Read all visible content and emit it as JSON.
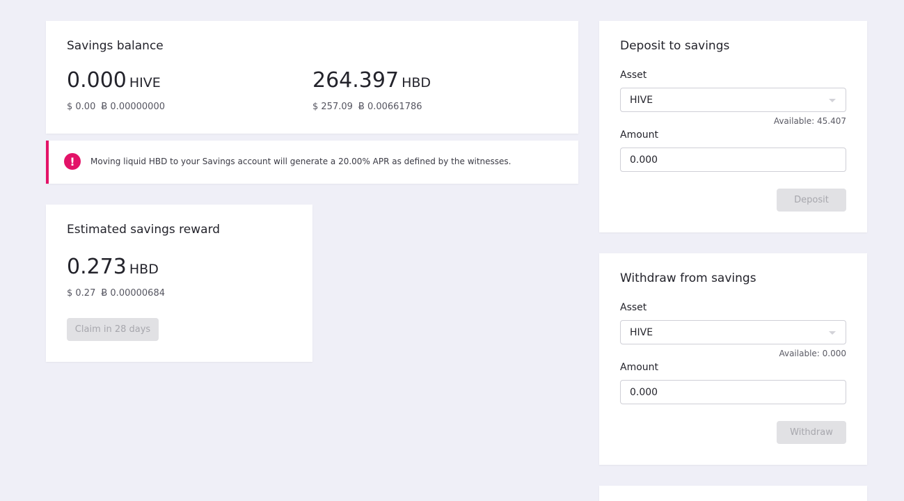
{
  "balance": {
    "title": "Savings balance",
    "hive": {
      "amount": "0.000",
      "unit": "HIVE",
      "usd": "$ 0.00",
      "btc": "Ƀ 0.00000000"
    },
    "hbd": {
      "amount": "264.397",
      "unit": "HBD",
      "usd": "$ 257.09",
      "btc": "Ƀ 0.00661786"
    }
  },
  "info": {
    "icon": "alert-icon",
    "icon_glyph": "!",
    "color": "#e31368",
    "text": "Moving liquid HBD to your Savings account will generate a 20.00% APR as defined by the witnesses."
  },
  "reward": {
    "title": "Estimated savings reward",
    "amount": "0.273",
    "unit": "HBD",
    "usd": "$ 0.27",
    "btc": "Ƀ 0.00000684",
    "claim_label": "Claim in 28 days"
  },
  "deposit": {
    "title": "Deposit to savings",
    "asset_label": "Asset",
    "asset_value": "HIVE",
    "available": "Available: 45.407",
    "amount_label": "Amount",
    "amount_value": "0.000",
    "button_label": "Deposit"
  },
  "withdraw": {
    "title": "Withdraw from savings",
    "asset_label": "Asset",
    "asset_value": "HIVE",
    "available": "Available: 0.000",
    "amount_label": "Amount",
    "amount_value": "0.000",
    "button_label": "Withdraw"
  }
}
